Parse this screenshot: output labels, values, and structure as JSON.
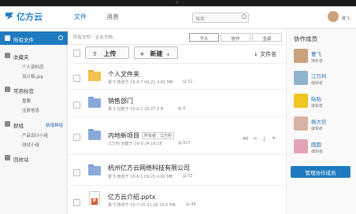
{
  "app": {
    "logo_text": "亿方云",
    "nav": {
      "files": "文件",
      "messages": "消息"
    },
    "search_placeholder": "搜索",
    "user": "曹飞"
  },
  "sidebar": {
    "items": [
      {
        "label": "所有文件"
      },
      {
        "label": "收藏夹"
      },
      {
        "label": "个人资料库"
      },
      {
        "label": "设计稿.jpg"
      },
      {
        "label": "常用标签"
      },
      {
        "label": "重要"
      },
      {
        "label": "注册信息"
      },
      {
        "label": "群组"
      },
      {
        "label": "新增群组"
      },
      {
        "label": "产品设计小组"
      },
      {
        "label": "测试小组"
      },
      {
        "label": "回收站"
      }
    ]
  },
  "breadcrumb": {
    "root": "所有文件",
    "current": "企业文档"
  },
  "view_tabs": {
    "personal": "个人",
    "collab": "协作",
    "all": "全部"
  },
  "toolbar": {
    "upload": "上传",
    "new": "新建",
    "sort": "文件名"
  },
  "files": [
    {
      "name": "个人文件夹",
      "meta": "曹飞 修改于 16-6-7 09:21 4.61 MB",
      "count": "52",
      "type": "folder",
      "owner": ""
    },
    {
      "name": "销售部门",
      "meta": "曹飞 创建于 16-6-1 16:27 0 B",
      "count": "0",
      "type": "group",
      "owner": ""
    },
    {
      "name": "内地新项目",
      "meta": "江万利 创建于 16-5-24 16:18",
      "count": "617",
      "type": "group",
      "owner": "所有者：江万利"
    },
    {
      "name": "杭州亿方云网络科技有限公司",
      "meta": "曹飞 修改于 16-6-1 09:21 4.61 MB",
      "count": "52",
      "type": "group",
      "owner": ""
    },
    {
      "name": "亿方云介绍.pptx",
      "meta": "曹飞 修改于 15-7-20 21:18 16.0 MB",
      "count": "49",
      "type": "pptx",
      "owner": ""
    }
  ],
  "right_panel": {
    "title": "协作成员",
    "members": [
      {
        "name": "曹飞",
        "role": "拥有者"
      },
      {
        "name": "江万利",
        "role": "编辑者"
      },
      {
        "name": "贴贴",
        "role": "编辑者"
      },
      {
        "name": "杨大信",
        "role": "编辑者"
      },
      {
        "name": "圆圆",
        "role": "编辑者"
      }
    ],
    "manage_button": "管理协作成员"
  },
  "colors": {
    "accent": "#1f7bc0",
    "folder": "#f2c14e",
    "group_folder": "#8aa9d9"
  }
}
